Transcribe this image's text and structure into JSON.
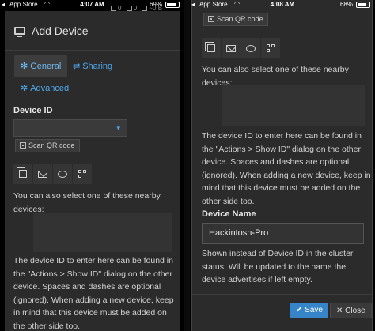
{
  "left": {
    "status": {
      "back": "◂",
      "carrier": "App Store",
      "time": "4:07 AM",
      "battery": "69%"
    },
    "peek_text": [
      "0",
      "0",
      "~0 B"
    ],
    "title": "Add Device",
    "tabs": [
      {
        "label": "General",
        "icon": "gear-icon"
      },
      {
        "label": "Sharing",
        "icon": "share-icon"
      },
      {
        "label": "Advanced",
        "icon": "gears-icon"
      }
    ],
    "device_id_label": "Device ID",
    "device_id_value": "",
    "scan_qr_label": "Scan QR code",
    "share_buttons": [
      "copy-icon",
      "mail-icon",
      "chat-icon",
      "qr-icon"
    ],
    "nearby_text": "You can also select one of these nearby devices:",
    "help_text": "The device ID to enter here can be found in the \"Actions > Show ID\" dialog on the other device. Spaces and dashes are optional (ignored). When adding a new device, keep in mind that this device must be added on the other side too."
  },
  "right": {
    "status": {
      "back": "◂",
      "carrier": "App Store",
      "time": "4:08 AM",
      "battery": "68%"
    },
    "scan_qr_label": "Scan QR code",
    "share_buttons": [
      "copy-icon",
      "mail-icon",
      "chat-icon",
      "qr-icon"
    ],
    "nearby_text": "You can also select one of these nearby devices:",
    "help_text": "The device ID to enter here can be found in the \"Actions > Show ID\" dialog on the other device. Spaces and dashes are optional (ignored). When adding a new device, keep in mind that this device must be added on the other side too.",
    "device_name_label": "Device Name",
    "device_name_value": "Hackintosh-Pro",
    "device_name_help": "Shown instead of Device ID in the cluster status. Will be updated to the name the device advertises if left empty.",
    "save_label": "Save",
    "close_label": "Close"
  }
}
